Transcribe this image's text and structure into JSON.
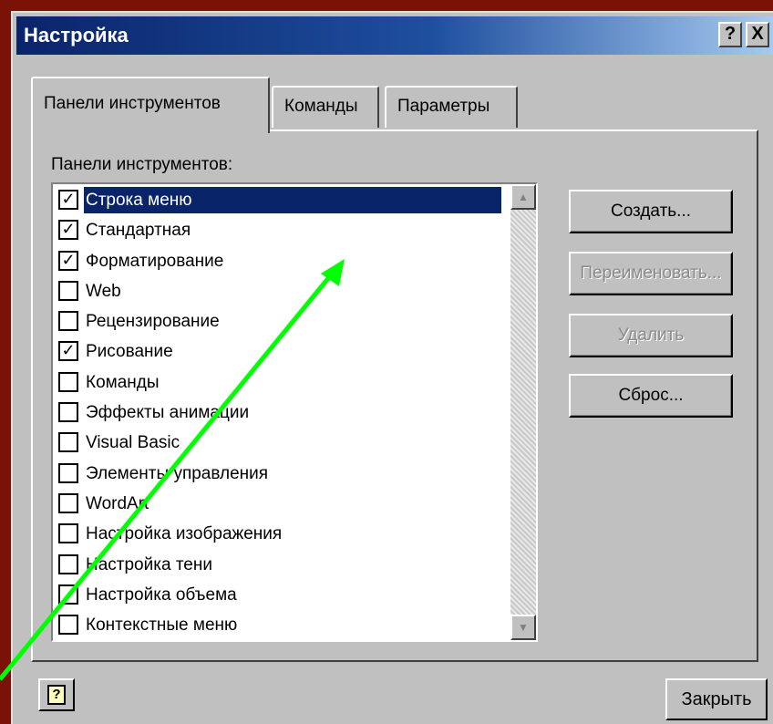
{
  "window": {
    "title": "Настройка",
    "help_label": "?",
    "close_label": "X"
  },
  "tabs": [
    {
      "label": "Панели инструментов",
      "active": true
    },
    {
      "label": "Команды",
      "active": false
    },
    {
      "label": "Параметры",
      "active": false
    }
  ],
  "list_label": "Панели инструментов:",
  "toolbars": [
    {
      "label": "Строка меню",
      "checked": true,
      "selected": true
    },
    {
      "label": "Стандартная",
      "checked": true
    },
    {
      "label": "Форматирование",
      "checked": true
    },
    {
      "label": "Web",
      "checked": false
    },
    {
      "label": "Рецензирование",
      "checked": false
    },
    {
      "label": "Рисование",
      "checked": true
    },
    {
      "label": "Команды",
      "checked": false
    },
    {
      "label": "Эффекты анимации",
      "checked": false
    },
    {
      "label": "Visual Basic",
      "checked": false
    },
    {
      "label": "Элементы управления",
      "checked": false
    },
    {
      "label": "WordArt",
      "checked": false
    },
    {
      "label": "Настройка изображения",
      "checked": false
    },
    {
      "label": "Настройка тени",
      "checked": false
    },
    {
      "label": "Настройка объема",
      "checked": false
    },
    {
      "label": "Контекстные меню",
      "checked": false
    }
  ],
  "buttons": {
    "create": "Создать...",
    "rename": "Переименовать...",
    "delete": "Удалить",
    "reset": "Сброс...",
    "close": "Закрыть",
    "help": "?"
  },
  "check_mark": "✓",
  "colors": {
    "arrow": "#00ff00",
    "selection": "#0a246a",
    "title_bar": "#0a246a"
  }
}
